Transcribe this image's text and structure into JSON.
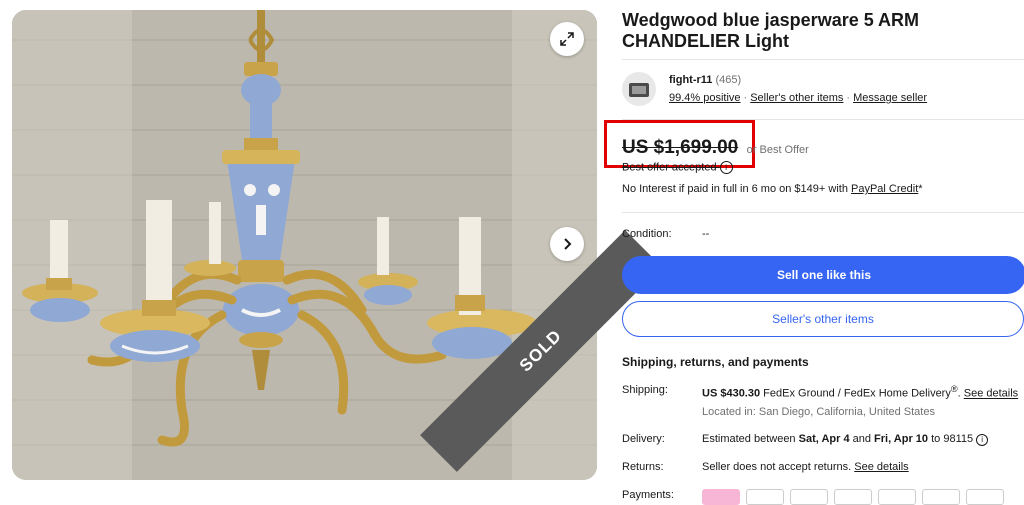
{
  "item": {
    "title": "Wedgwood blue jasperware 5 ARM CHANDELIER Light",
    "sold_label": "SOLD"
  },
  "seller": {
    "name": "fight-r11",
    "feedback_count": "(465)",
    "positive": "99.4% positive",
    "other_items_link": "Seller's other items",
    "message_link": "Message seller"
  },
  "pricing": {
    "price": "US $1,699.00",
    "or_best_offer": "or Best Offer",
    "best_offer_accepted": "Best offer accepted",
    "financing_prefix": "No Interest if paid in full in 6 mo on $149+ with ",
    "financing_link": "PayPal Credit",
    "financing_suffix": "*"
  },
  "condition": {
    "label": "Condition:",
    "value": "--"
  },
  "actions": {
    "sell_one": "Sell one like this",
    "sellers_other_items": "Seller's other items"
  },
  "shipping": {
    "section_title": "Shipping, returns, and payments",
    "shipping_label": "Shipping:",
    "shipping_price": "US $430.30",
    "shipping_method": " FedEx Ground / FedEx Home Delivery",
    "shipping_sup": "®",
    "see_details": "See details",
    "location": "Located in: San Diego, California, United States",
    "delivery_label": "Delivery:",
    "delivery_prefix": "Estimated between ",
    "delivery_start": "Sat, Apr 4",
    "delivery_and": " and ",
    "delivery_end": "Fri, Apr 10",
    "delivery_suffix": " to 98115",
    "returns_label": "Returns:",
    "returns_text": "Seller does not accept returns. ",
    "returns_link": "See details",
    "payments_label": "Payments:"
  },
  "colors": {
    "accent_blue": "#3665f3",
    "highlight_red": "#e00000",
    "sold_ribbon": "#5a5a5a"
  },
  "icons": {
    "expand": "expand-icon",
    "next": "chevron-right-icon",
    "info": "info-icon"
  }
}
